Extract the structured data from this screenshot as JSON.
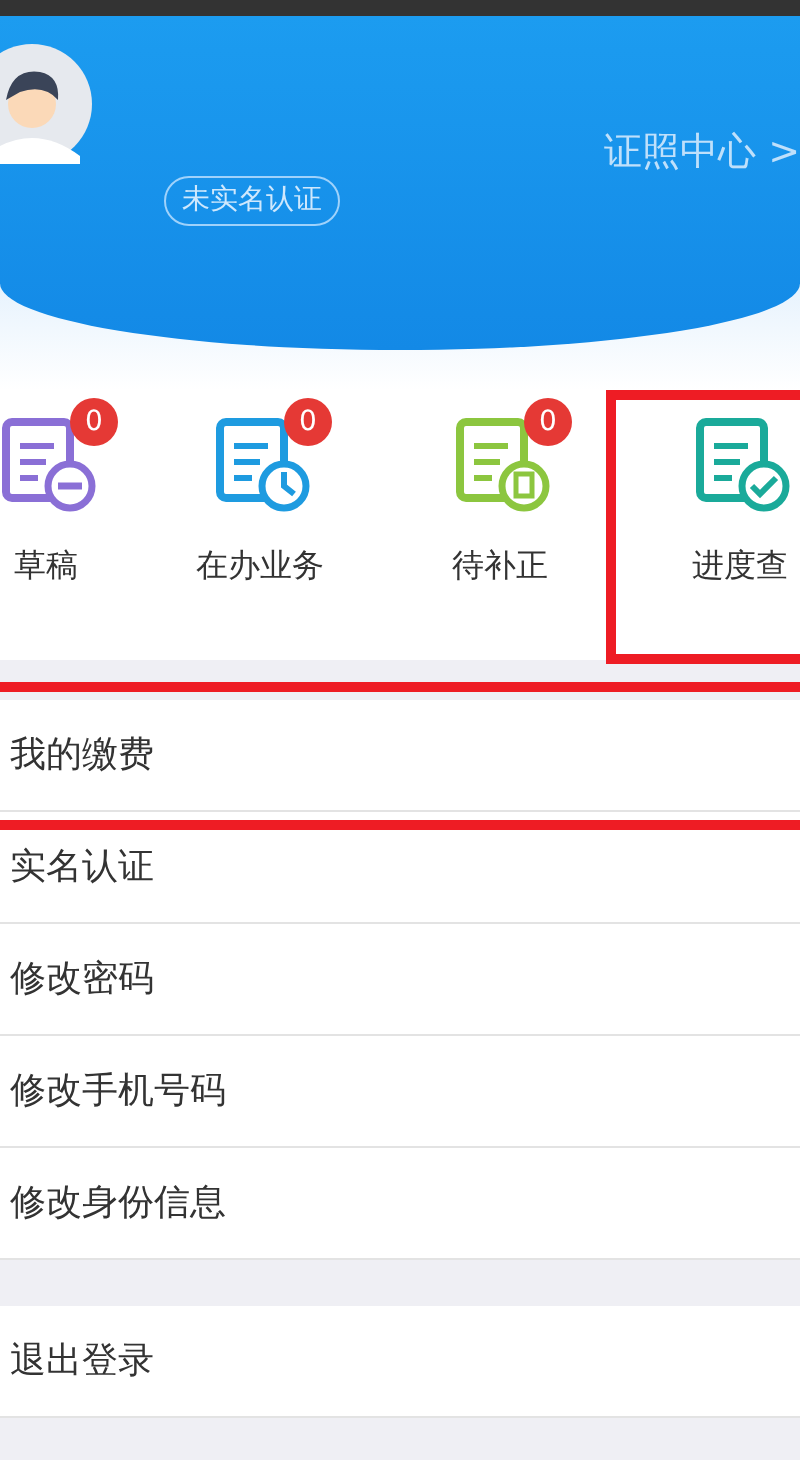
{
  "header": {
    "verify_badge": "未实名认证",
    "cert_link": "证照中心 >"
  },
  "shortcuts": [
    {
      "kind": "draft",
      "label": "草稿",
      "count": "0",
      "color": "#8a6fd6",
      "highlighted": false
    },
    {
      "kind": "clock",
      "label": "在办业务",
      "count": "0",
      "color": "#1e9be0",
      "highlighted": false
    },
    {
      "kind": "doc",
      "label": "待补正",
      "count": "0",
      "color": "#8cc63f",
      "highlighted": false
    },
    {
      "kind": "check",
      "label": "进度查",
      "color": "#1aaa9a",
      "highlighted": true
    }
  ],
  "menu_groups": [
    [
      {
        "label": "我的缴费",
        "highlighted": true
      },
      {
        "label": "实名认证",
        "highlighted": false
      },
      {
        "label": "修改密码",
        "highlighted": false
      },
      {
        "label": "修改手机号码",
        "highlighted": false
      },
      {
        "label": "修改身份信息",
        "highlighted": false
      }
    ],
    [
      {
        "label": "退出登录",
        "highlighted": false
      }
    ]
  ]
}
